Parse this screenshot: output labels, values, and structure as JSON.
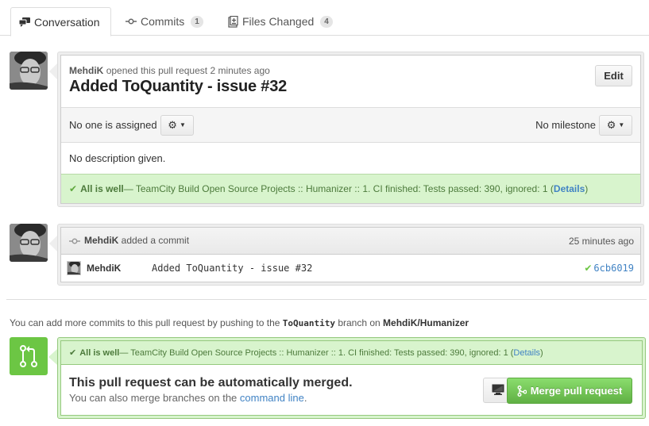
{
  "tabs": [
    {
      "label": "Conversation",
      "icon": "comment-discussion-icon",
      "active": true
    },
    {
      "label": "Commits",
      "icon": "git-commit-icon",
      "count": "1"
    },
    {
      "label": "Files Changed",
      "icon": "diff-icon",
      "count": "4"
    }
  ],
  "pull_request": {
    "author": "MehdiK",
    "action": "opened this pull request 2 minutes ago",
    "title": "Added ToQuantity - issue #32",
    "edit_label": "Edit",
    "assignee_text": "No one is assigned",
    "milestone_text": "No milestone",
    "description": "No description given.",
    "status": {
      "check": "✔",
      "headline": "All is well",
      "text": " — TeamCity Build Open Source Projects :: Humanizer :: 1. CI finished: Tests passed: 390, ignored: 1 (",
      "details_label": "Details",
      "close": ")"
    }
  },
  "commit_event": {
    "author": "MehdiK",
    "action": " added a commit",
    "time": "25 minutes ago",
    "commit": {
      "author": "MehdiK",
      "message": "Added ToQuantity - issue #32",
      "status_icon": "✔",
      "sha": "6cb6019"
    }
  },
  "push_note": {
    "prefix": "You can add more commits to this pull request by pushing to the ",
    "branch": "ToQuantity",
    "middle": " branch on ",
    "repo": "MehdiK/Humanizer"
  },
  "merge": {
    "status": {
      "check": "✔",
      "headline": "All is well",
      "text": " — TeamCity Build Open Source Projects :: Humanizer :: 1. CI finished: Tests passed: 390, ignored: 1 (",
      "details_label": "Details",
      "close": ")"
    },
    "title": "This pull request can be automatically merged.",
    "sub_prefix": "You can also merge branches on the ",
    "sub_link": "command line",
    "sub_suffix": ".",
    "merge_button_label": "Merge pull request"
  },
  "colors": {
    "success_green": "#6cc644",
    "status_bg": "#d8f4cd",
    "link_blue": "#4183c4"
  }
}
